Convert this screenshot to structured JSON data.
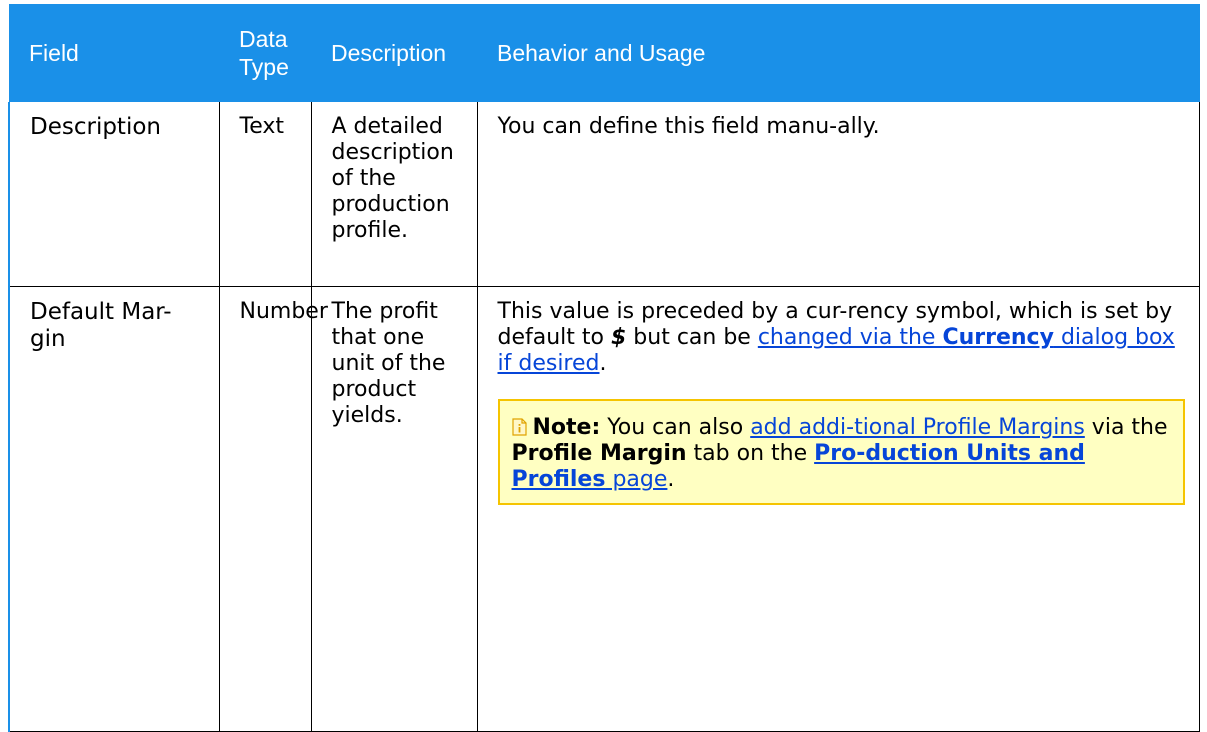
{
  "table": {
    "headers": {
      "field": "Field",
      "data_type": "Data Type",
      "description": "Description",
      "behavior": "Behavior and Usage"
    },
    "rows": [
      {
        "field": "Description",
        "data_type": "Text",
        "description": "A detailed description of the production profile.",
        "behavior": "You can define this field manu-ally."
      },
      {
        "field": "Default Mar-gin",
        "data_type": "Number",
        "description": "The profit that one unit of the product yields.",
        "behavior": {
          "text_before": "This value is preceded by a cur-rency symbol, which is set by default to ",
          "symbol": "$",
          "text_middle": " but can be ",
          "link1_part1": "changed via the ",
          "link1_bold": "Currency",
          "link1_part2": " dialog box if desired",
          "text_after": ".",
          "note": {
            "label": "Note:",
            "text_before": " You can also ",
            "link": "add addi-tional Profile Margins",
            "text_middle": " via the ",
            "bold": "Profile Margin",
            "text_middle2": " tab on the ",
            "link2_bold": "Pro-duction Units and Profiles",
            "link2_plain": " page",
            "text_after": "."
          }
        }
      }
    ]
  },
  "colors": {
    "header_bg": "#1a90e8",
    "link": "#0645d8",
    "note_bg": "#ffffc2",
    "note_border": "#f5c400"
  },
  "icons": {
    "note": "note-icon"
  }
}
